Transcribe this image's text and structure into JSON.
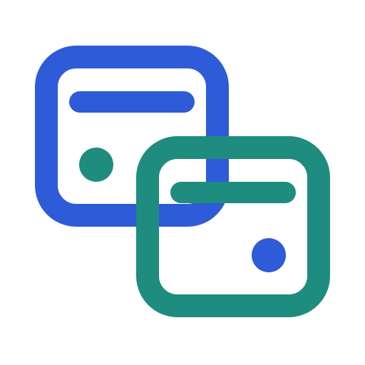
{
  "icon": {
    "name": "two-overlapping-cards-icon",
    "description_elements": [
      "back-card",
      "front-card"
    ],
    "colors": {
      "blue": "#2E5BD8",
      "teal": "#1E8C7E",
      "background": "#FFFFFF"
    }
  }
}
